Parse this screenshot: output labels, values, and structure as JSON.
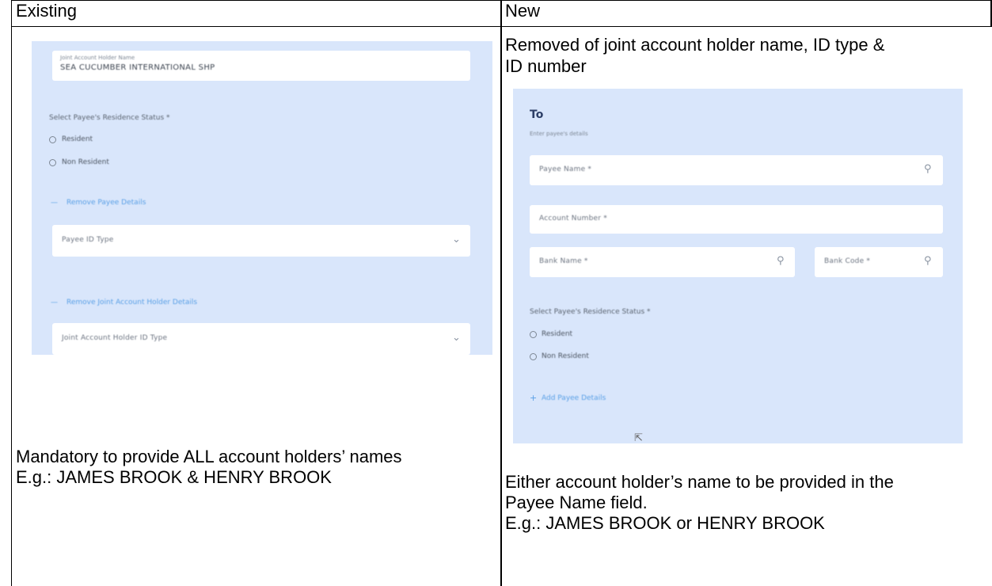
{
  "headers": {
    "existing": "Existing",
    "new": "New"
  },
  "new_caption_top": [
    "Removed of joint account holder name, ID type &",
    "ID number"
  ],
  "existing_caption": [
    "Mandatory to provide ALL account holders’ names",
    "E.g.: JAMES BROOK & HENRY BROOK"
  ],
  "new_caption_bottom": [
    "Either account holder’s name to be provided in the",
    "Payee Name field.",
    "E.g.: JAMES BROOK or HENRY BROOK"
  ],
  "existing_shot": {
    "joint_name_label": "Joint Account Holder Name",
    "joint_name_value": "SEA CUCUMBER INTERNATIONAL SHP",
    "residence_label": "Select Payee's Residence Status *",
    "options": [
      "Resident",
      "Non Resident"
    ],
    "remove_payee_link": "Remove Payee Details",
    "payee_id_type": "Payee ID Type",
    "remove_joint_link": "Remove Joint Account Holder Details",
    "joint_id_type": "Joint Account Holder ID Type"
  },
  "new_shot": {
    "title": "To",
    "subtitle": "Enter payee's details",
    "payee_name": "Payee Name *",
    "account_number": "Account Number *",
    "bank_name": "Bank Name *",
    "bank_code": "Bank Code *",
    "residence_label": "Select Payee's Residence Status *",
    "options": [
      "Resident",
      "Non Resident"
    ],
    "add_payee_link": "Add Payee Details"
  },
  "colors": {
    "panel": "#d9e6fb",
    "link": "#5aa0e6"
  }
}
